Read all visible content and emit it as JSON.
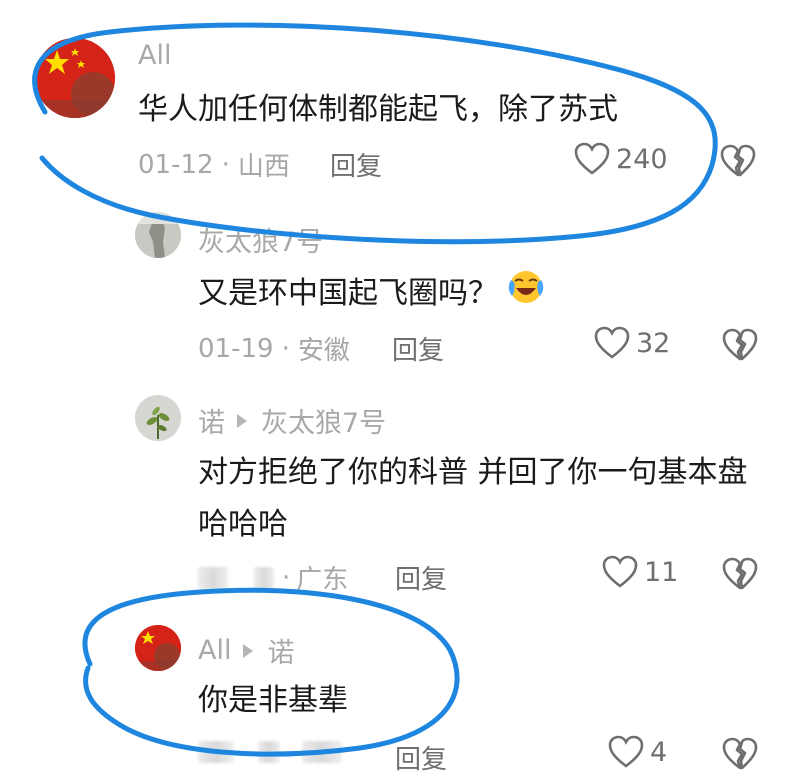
{
  "comments": [
    {
      "username": "All",
      "text": "华人加任何体制都能起飞，除了苏式",
      "date": "01-12",
      "location": "山西",
      "reply_label": "回复",
      "likes": "240",
      "avatar": "china-flag-avatar"
    },
    {
      "username": "灰太狼7号",
      "text": "又是环中国起飞圈吗？",
      "emoji": "laughing-crying-emoji",
      "date": "01-19",
      "location": "安徽",
      "reply_label": "回复",
      "likes": "32",
      "avatar": "statue-avatar"
    },
    {
      "username": "诺",
      "reply_to": "灰太狼7号",
      "text": "对方拒绝了你的科普 并回了你一句基本盘 哈哈哈",
      "location": "广东",
      "reply_label": "回复",
      "likes": "11",
      "avatar": "plant-avatar"
    },
    {
      "username": "All",
      "reply_to": "诺",
      "text": "你是非基辈",
      "reply_label": "回复",
      "likes": "4",
      "avatar": "china-flag-avatar"
    }
  ],
  "separator": "·",
  "colors": {
    "annotation": "#1f86e0",
    "muted": "#a7a7a7",
    "icon": "#6f6f6f"
  }
}
